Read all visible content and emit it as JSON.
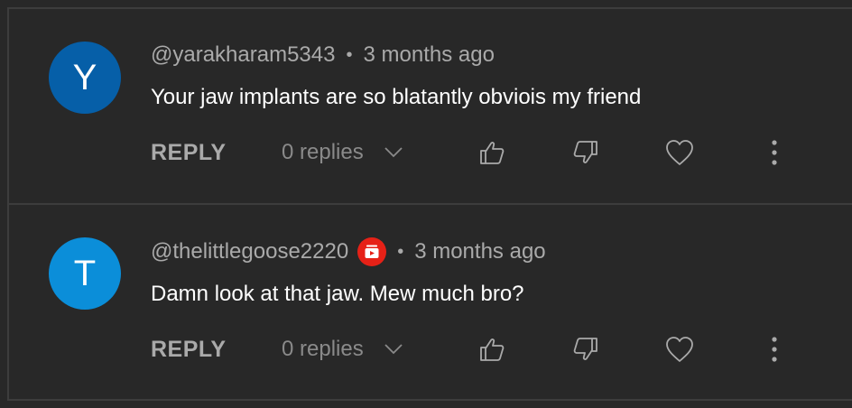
{
  "comments": [
    {
      "avatar_letter": "Y",
      "avatar_color": "#065fa8",
      "username": "@yarakharam5343",
      "separator": "•",
      "time": "3 months ago",
      "text": "Your jaw implants are so blatantly obviois my friend",
      "reply_label": "REPLY",
      "replies_label": "0 replies",
      "has_badge": false
    },
    {
      "avatar_letter": "T",
      "avatar_color": "#0b8ed9",
      "username": "@thelittlegoose2220",
      "separator": "•",
      "time": "3 months ago",
      "text": "Damn look at that jaw. Mew much bro?",
      "reply_label": "REPLY",
      "replies_label": "0 replies",
      "has_badge": true,
      "badge_icon": "youtube-creator-badge-icon",
      "badge_color": "#e62117"
    }
  ],
  "icons": {
    "like": "thumbs-up-icon",
    "dislike": "thumbs-down-icon",
    "heart": "heart-icon",
    "more": "more-vertical-icon",
    "expand": "chevron-down-icon"
  },
  "colors": {
    "background": "#282828",
    "divider": "#3d3d3d",
    "muted_text": "#aaaaaa"
  }
}
